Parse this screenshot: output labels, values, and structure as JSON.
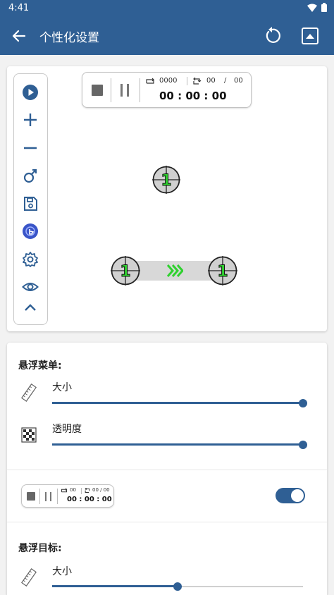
{
  "status_bar": {
    "time": "4:41",
    "icons": [
      "wifi-icon",
      "battery-icon"
    ]
  },
  "app_bar": {
    "title": "个性化设置",
    "icons": [
      "back-arrow-icon",
      "reset-icon",
      "collapse-up-icon"
    ]
  },
  "floating_toolbar": {
    "buttons": [
      "play-icon",
      "plus-icon",
      "minus-icon",
      "swipe-icon",
      "save-icon",
      "click-hand-icon",
      "gear-icon",
      "eye-icon",
      "chevron-up-icon"
    ]
  },
  "preview_timer": {
    "loop_count": "0000",
    "round_current": "00",
    "round_sep": "/",
    "round_total": "00",
    "clock": "00 : 00 : 00"
  },
  "targets": {
    "click_target_label": "1",
    "swipe_start_label": "1",
    "swipe_end_label": "1"
  },
  "settings": {
    "floating_menu": {
      "title": "悬浮菜单:",
      "size_label": "大小",
      "size_value": 1.0,
      "opacity_label": "透明度",
      "opacity_value": 1.0
    },
    "mini_timer": {
      "loop_count": "00",
      "round": "00 / 00",
      "clock": "00 : 00 : 00",
      "toggle_on": true
    },
    "floating_target": {
      "title": "悬浮目标:",
      "size_label": "大小",
      "size_value": 0.5
    }
  },
  "colors": {
    "primary": "#2f5f94",
    "target_green": "#2fd12f"
  }
}
